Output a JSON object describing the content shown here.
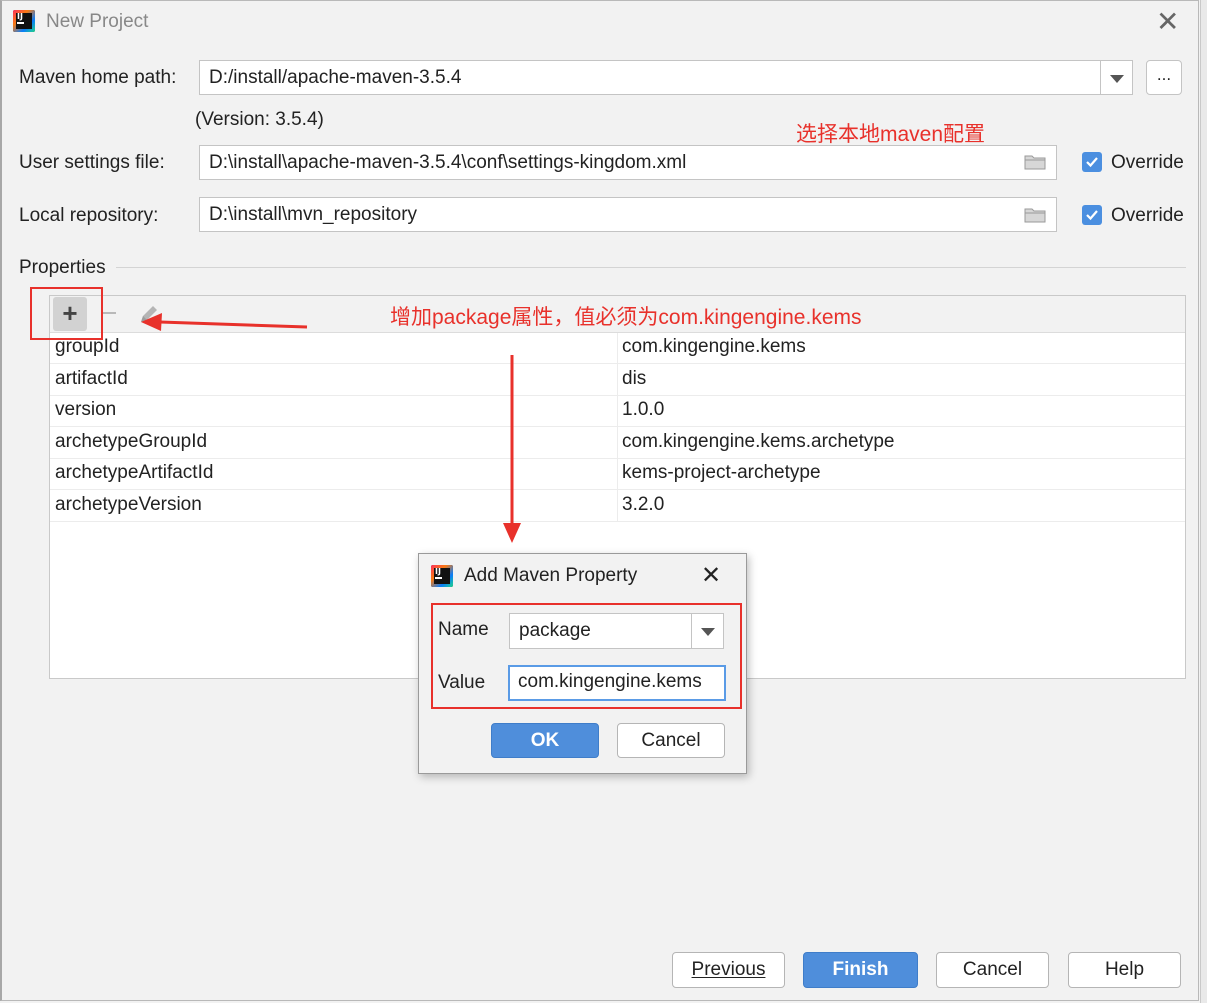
{
  "window": {
    "title": "New Project",
    "accent_color": "#4b8fe0",
    "annotation_color": "#e8312b"
  },
  "maven": {
    "home_path_label": "Maven home path:",
    "home_path_value": "D:/install/apache-maven-3.5.4",
    "browse_label": "...",
    "version_text": "(Version: 3.5.4)",
    "settings_label": "User settings file:",
    "settings_value": "D:\\install\\apache-maven-3.5.4\\conf\\settings-kingdom.xml",
    "repo_label": "Local repository:",
    "repo_value": "D:\\install\\mvn_repository",
    "override_label": "Override"
  },
  "annotations": {
    "local_maven": "选择本地maven配置",
    "add_package": "增加package属性，值必须为com.kingengine.kems"
  },
  "properties": {
    "section_label": "Properties",
    "rows": [
      {
        "key": "groupId",
        "value": "com.kingengine.kems"
      },
      {
        "key": "artifactId",
        "value": "dis"
      },
      {
        "key": "version",
        "value": "1.0.0"
      },
      {
        "key": "archetypeGroupId",
        "value": "com.kingengine.kems.archetype"
      },
      {
        "key": "archetypeArtifactId",
        "value": "kems-project-archetype"
      },
      {
        "key": "archetypeVersion",
        "value": "3.2.0"
      }
    ]
  },
  "dialog": {
    "title": "Add Maven Property",
    "name_label": "Name",
    "name_value": "package",
    "value_label": "Value",
    "value_value": "com.kingengine.kems",
    "ok_label": "OK",
    "cancel_label": "Cancel"
  },
  "footer": {
    "previous_label": "Previous",
    "finish_label": "Finish",
    "cancel_label": "Cancel",
    "help_label": "Help"
  }
}
